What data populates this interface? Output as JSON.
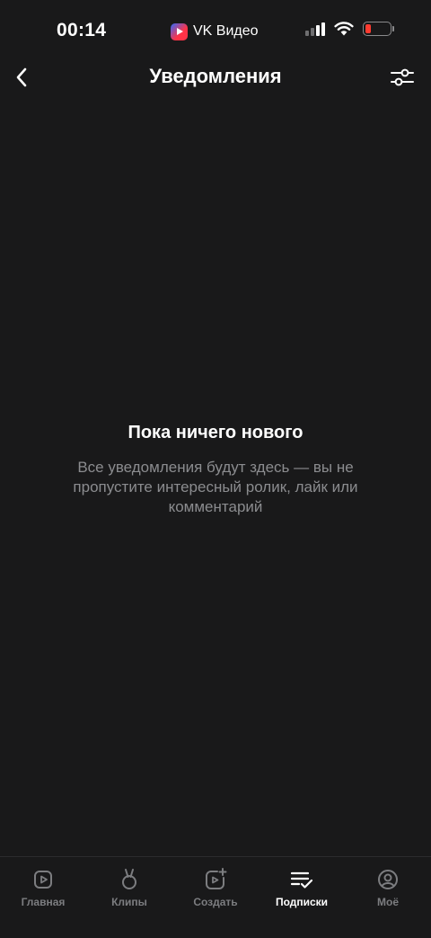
{
  "status_bar": {
    "time": "00:14",
    "app_indicator": "VK Видео",
    "battery_color": "#ff3b30"
  },
  "header": {
    "title": "Уведомления",
    "back_icon": "chevron-left-icon",
    "filter_icon": "sliders-icon"
  },
  "empty_state": {
    "title": "Пока ничего нового",
    "text": "Все уведомления будут здесь — вы не пропустите интересный ролик, лайк или комментарий"
  },
  "tabbar": {
    "items": [
      {
        "label": "Главная",
        "icon": "play-square-icon",
        "active": false
      },
      {
        "label": "Клипы",
        "icon": "clips-icon",
        "active": false
      },
      {
        "label": "Создать",
        "icon": "create-video-icon",
        "active": false
      },
      {
        "label": "Подписки",
        "icon": "subscriptions-icon",
        "active": true
      },
      {
        "label": "Моё",
        "icon": "profile-icon",
        "active": false
      }
    ]
  }
}
